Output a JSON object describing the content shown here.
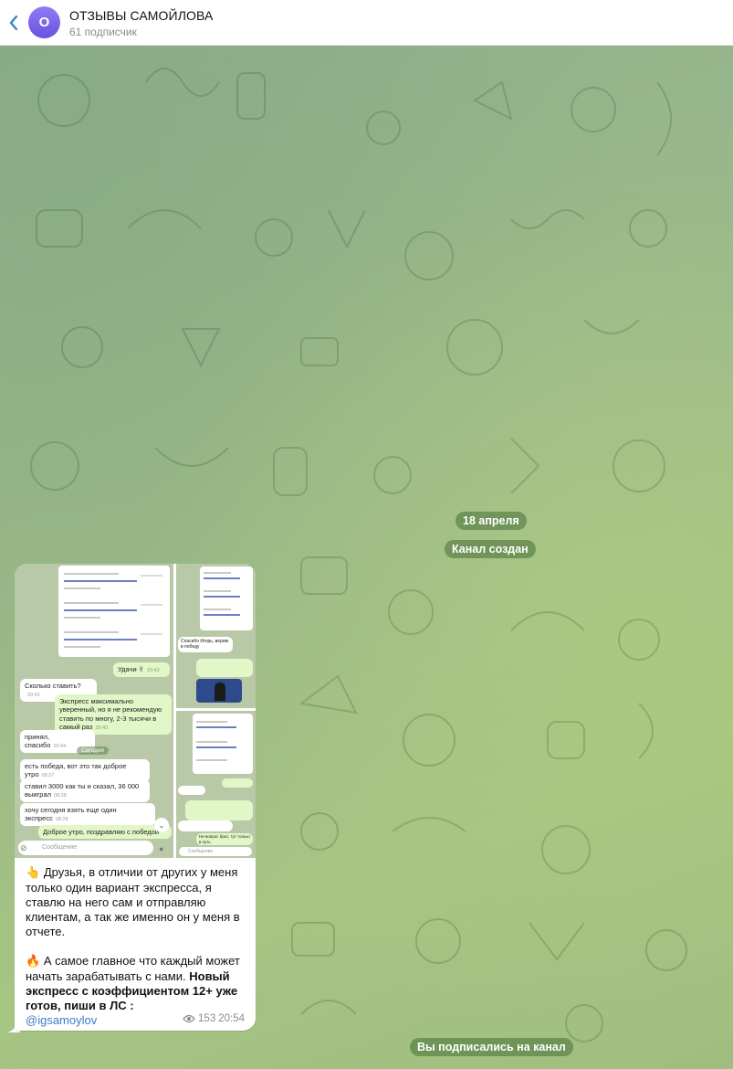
{
  "header": {
    "avatar_letter": "О",
    "title": "ОТЗЫВЫ САМОЙЛОВА",
    "subtitle": "61 подписчик"
  },
  "service": {
    "date": "18 апреля",
    "created": "Канал создан",
    "subscribed": "Вы подписались на канал"
  },
  "post": {
    "media": {
      "left": {
        "messages": [
          {
            "text": "Удачи ✌",
            "time": "20:42"
          },
          {
            "text": "Сколько ставить?",
            "time": "20:42"
          },
          {
            "text": "Экспресс максимально уверенный, но я не рекомендую ставить по многу, 2-3 тысячи в самый раз",
            "time": "20:43"
          },
          {
            "text": "принял, спасибо",
            "time": "20:44"
          },
          {
            "text": "Сегодня"
          },
          {
            "text": "есть победа, вот это так доброе утро",
            "time": "08:27"
          },
          {
            "text": "ставил 3000 как ты и сказал, 36 000 выиграл",
            "time": "08:28"
          },
          {
            "text": "хочу сегодня взять еще один экспресс",
            "time": "08:28"
          },
          {
            "text": "Доброе утро, поздравляю с победой"
          }
        ],
        "input_placeholder": "Сообщение"
      },
      "right_top": {
        "message": "Спасибо Игорь, верим в победу"
      },
      "right_bottom": {
        "message": "Не вопрос брат, тут только в путь",
        "input_placeholder": "Сообщение"
      }
    },
    "caption": {
      "line1_emoji": "👆",
      "line1": "Друзья, в отличии от других у меня только один вариант экспресса, я ставлю на него сам и отправляю клиентам, а так же именно он у меня в отчете.",
      "line2_emoji": "🔥",
      "line2": "А самое главное что каждый может начать зарабатывать с нами.",
      "line3": "Новый экспресс с коэффициентом 12+ уже готов, пиши в ЛС :",
      "link": "@igsamoylov"
    },
    "views": "153",
    "time": "20:54"
  },
  "colors": {
    "accent": "#3a7cc6",
    "pill_bg": "#5c8248",
    "outgoing_bubble": "#e2f7c7",
    "avatar": "#7b66ea"
  }
}
